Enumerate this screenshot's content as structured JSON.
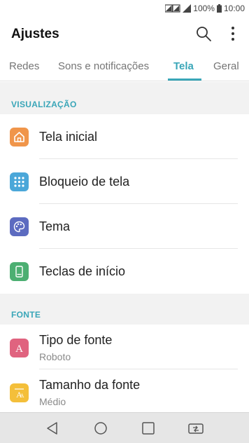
{
  "status_bar": {
    "battery": "100%",
    "time": "10:00"
  },
  "app_bar": {
    "title": "Ajustes"
  },
  "tabs": [
    {
      "label": "Redes"
    },
    {
      "label": "Sons e notificações"
    },
    {
      "label": "Tela",
      "active": true
    },
    {
      "label": "Geral"
    }
  ],
  "sections": [
    {
      "header": "VISUALIZAÇÃO",
      "items": [
        {
          "title": "Tela inicial",
          "icon": "home-icon",
          "color": "#f0954a"
        },
        {
          "title": "Bloqueio de tela",
          "icon": "lock-screen-icon",
          "color": "#4ba7d9"
        },
        {
          "title": "Tema",
          "icon": "palette-icon",
          "color": "#5c6bc0"
        },
        {
          "title": "Teclas de início",
          "icon": "home-touch-buttons-icon",
          "color": "#4caf72"
        }
      ]
    },
    {
      "header": "FONTE",
      "items": [
        {
          "title": "Tipo de fonte",
          "subtitle": "Roboto",
          "icon": "font-type-icon",
          "color": "#e0637f"
        },
        {
          "title": "Tamanho da fonte",
          "subtitle": "Médio",
          "icon": "font-size-icon",
          "color": "#f4bf3a"
        }
      ]
    }
  ],
  "accent_color": "#3aa6b8"
}
